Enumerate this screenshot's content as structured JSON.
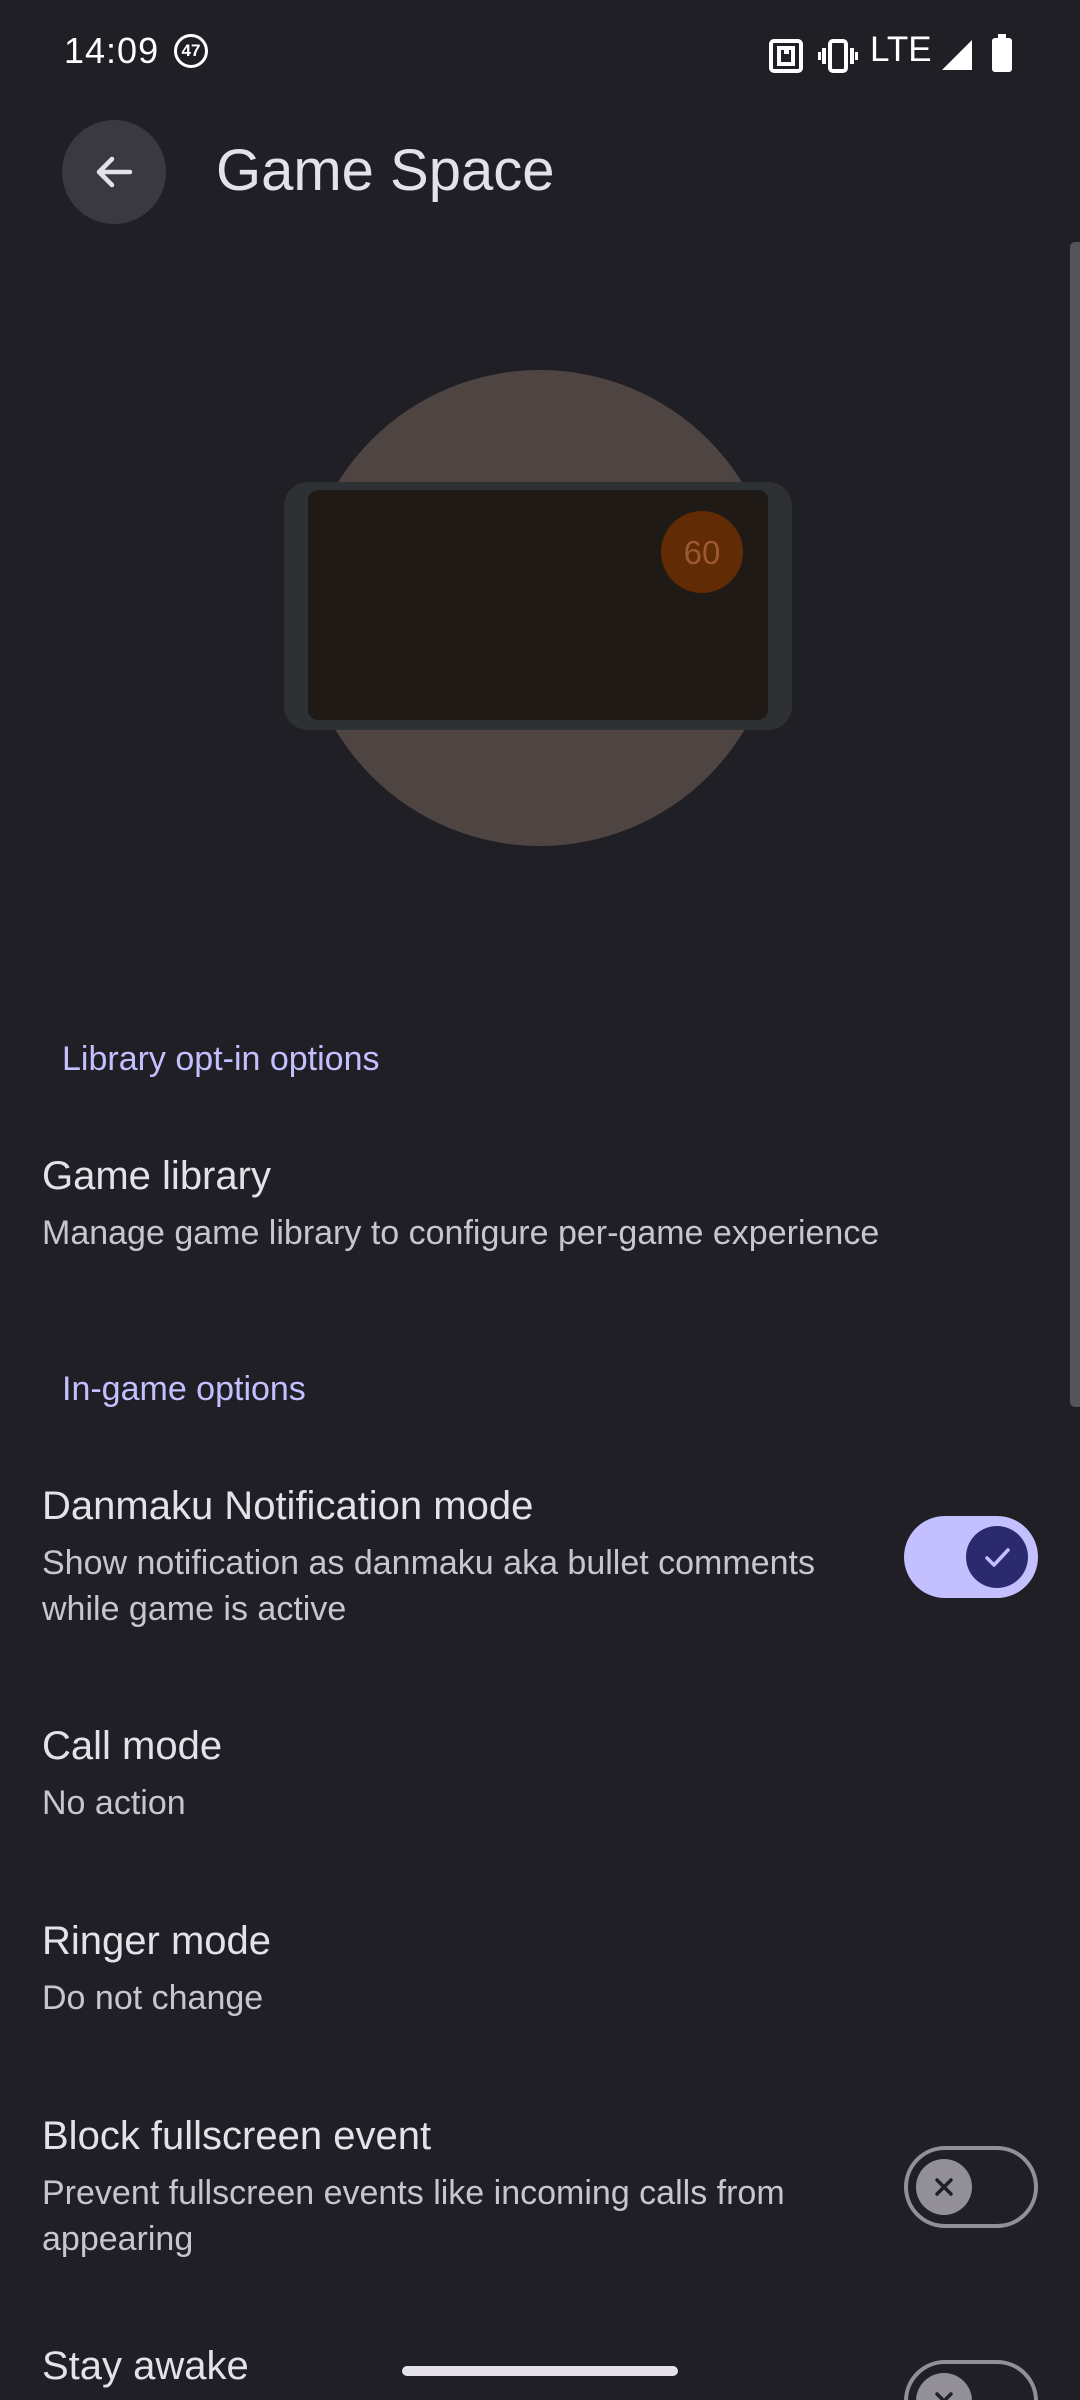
{
  "status_bar": {
    "time": "14:09",
    "notification_count": "47",
    "network": "LTE",
    "icons": [
      "nfc-icon",
      "vibrate-icon",
      "signal-icon",
      "battery-icon"
    ]
  },
  "header": {
    "title": "Game Space",
    "back_icon": "arrow-back-icon"
  },
  "illustration": {
    "fps_badge": "60"
  },
  "sections": {
    "library": {
      "header": "Library opt-in options",
      "game_library": {
        "title": "Game library",
        "summary": "Manage game library to configure per-game experience"
      }
    },
    "in_game": {
      "header": "In-game options",
      "danmaku": {
        "title": "Danmaku Notification mode",
        "summary": "Show notification as danmaku aka bullet comments while game is active",
        "enabled": true
      },
      "call_mode": {
        "title": "Call mode",
        "summary": "No action"
      },
      "ringer_mode": {
        "title": "Ringer mode",
        "summary": "Do not change"
      },
      "block_fullscreen": {
        "title": "Block fullscreen event",
        "summary": "Prevent fullscreen events like incoming calls from appearing",
        "enabled": false
      },
      "stay_awake": {
        "title": "Stay awake",
        "enabled": false
      }
    }
  },
  "colors": {
    "background": "#201f25",
    "accent": "#c4c0ff",
    "switch_thumb_on": "#2c2a6f",
    "switch_off": "#928f99",
    "illustration_circle": "#4e4543",
    "fps_badge": "#612b05"
  }
}
